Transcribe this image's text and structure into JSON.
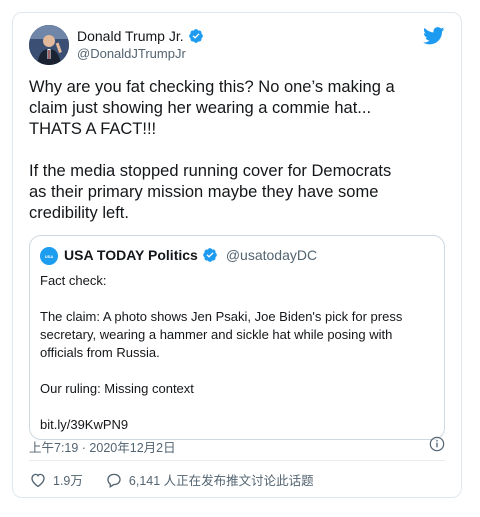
{
  "author": {
    "name": "Donald Trump Jr.",
    "handle": "@DonaldJTrumpJr"
  },
  "tweet": {
    "text": "Why are you fat checking this? No one’s making a\nclaim just showing her wearing a commie hat...\nTHATS A FACT!!!\n\nIf the media stopped running cover for Democrats\nas their primary mission maybe they have some\ncredibility left."
  },
  "quoted": {
    "name": "USA TODAY Politics",
    "handle": "@usatodayDC",
    "avatar_text": "USA",
    "text": "Fact check:\n\nThe claim: A photo shows Jen Psaki, Joe Biden's pick for press\nsecretary, wearing a hammer and sickle hat while posing with\nofficials from Russia.\n\nOur ruling: Missing context\n\nbit.ly/39KwPN9"
  },
  "meta": {
    "timestamp": "上午7:19 · 2020年12月2日",
    "likes": "1.9万",
    "discussion": "6,141 人正在发布推文讨论此话题"
  },
  "colors": {
    "twitter_blue": "#1d9bf0",
    "secondary_text": "#536471",
    "border": "#cfd9de"
  },
  "icons": [
    "twitter-bird-icon",
    "verified-badge-icon",
    "info-icon",
    "heart-icon",
    "comment-bubble-icon"
  ]
}
